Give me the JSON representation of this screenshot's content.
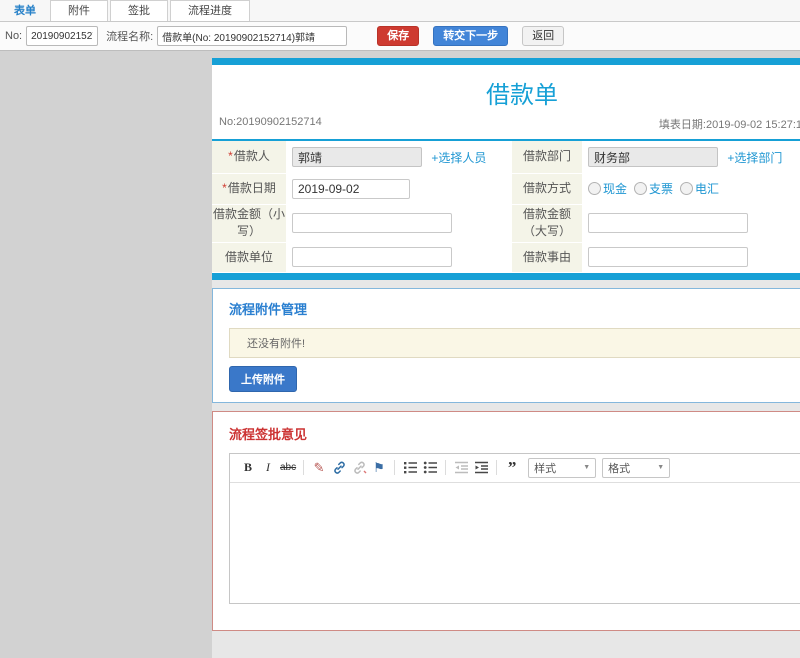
{
  "tabs": [
    {
      "label": "表单",
      "active": true
    },
    {
      "label": "附件"
    },
    {
      "label": "签批"
    },
    {
      "label": "流程进度"
    }
  ],
  "toolbar": {
    "no_label": "No:",
    "no_value": "20190902152714",
    "name_label": "流程名称:",
    "name_value": "借款单(No: 20190902152714)郭靖",
    "save_label": "保存",
    "next_label": "转交下一步",
    "back_label": "返回"
  },
  "form": {
    "title": "借款单",
    "no_text": "No:20190902152714",
    "date_text": "填表日期:2019-09-02 15:27:1",
    "required_mark": "*",
    "fields": {
      "borrower": {
        "label": "借款人",
        "value": "郭靖",
        "link": "+选择人员"
      },
      "department": {
        "label": "借款部门",
        "value": "财务部",
        "link": "+选择部门"
      },
      "loan_date": {
        "label": "借款日期",
        "value": "2019-09-02"
      },
      "method": {
        "label": "借款方式",
        "options": [
          "现金",
          "支票",
          "电汇"
        ]
      },
      "amount_small": {
        "label": "借款金额（小写）",
        "value": ""
      },
      "amount_big": {
        "label": "借款金额（大写）",
        "value": ""
      },
      "unit": {
        "label": "借款单位",
        "value": ""
      },
      "reason": {
        "label": "借款事由",
        "value": ""
      }
    }
  },
  "attachments": {
    "heading": "流程附件管理",
    "empty_text": "还没有附件!",
    "upload_label": "上传附件"
  },
  "signoff": {
    "heading": "流程签批意见",
    "editor": {
      "bold": "B",
      "italic": "I",
      "strike": "abc",
      "remove_format": "✎",
      "anchor": "⚑",
      "quote": "”",
      "styles_label": "样式",
      "format_label": "格式",
      "caret": "▼"
    }
  },
  "colors": {
    "accent_blue": "#16a0d6",
    "link_blue": "#1e96d2",
    "heading_blue": "#2a7fd0",
    "heading_red": "#cc3333",
    "save_red": "#ce3a30",
    "primary_blue": "#4285d8",
    "upload_blue": "#3a78c9",
    "label_beige": "#f4f4e8"
  }
}
